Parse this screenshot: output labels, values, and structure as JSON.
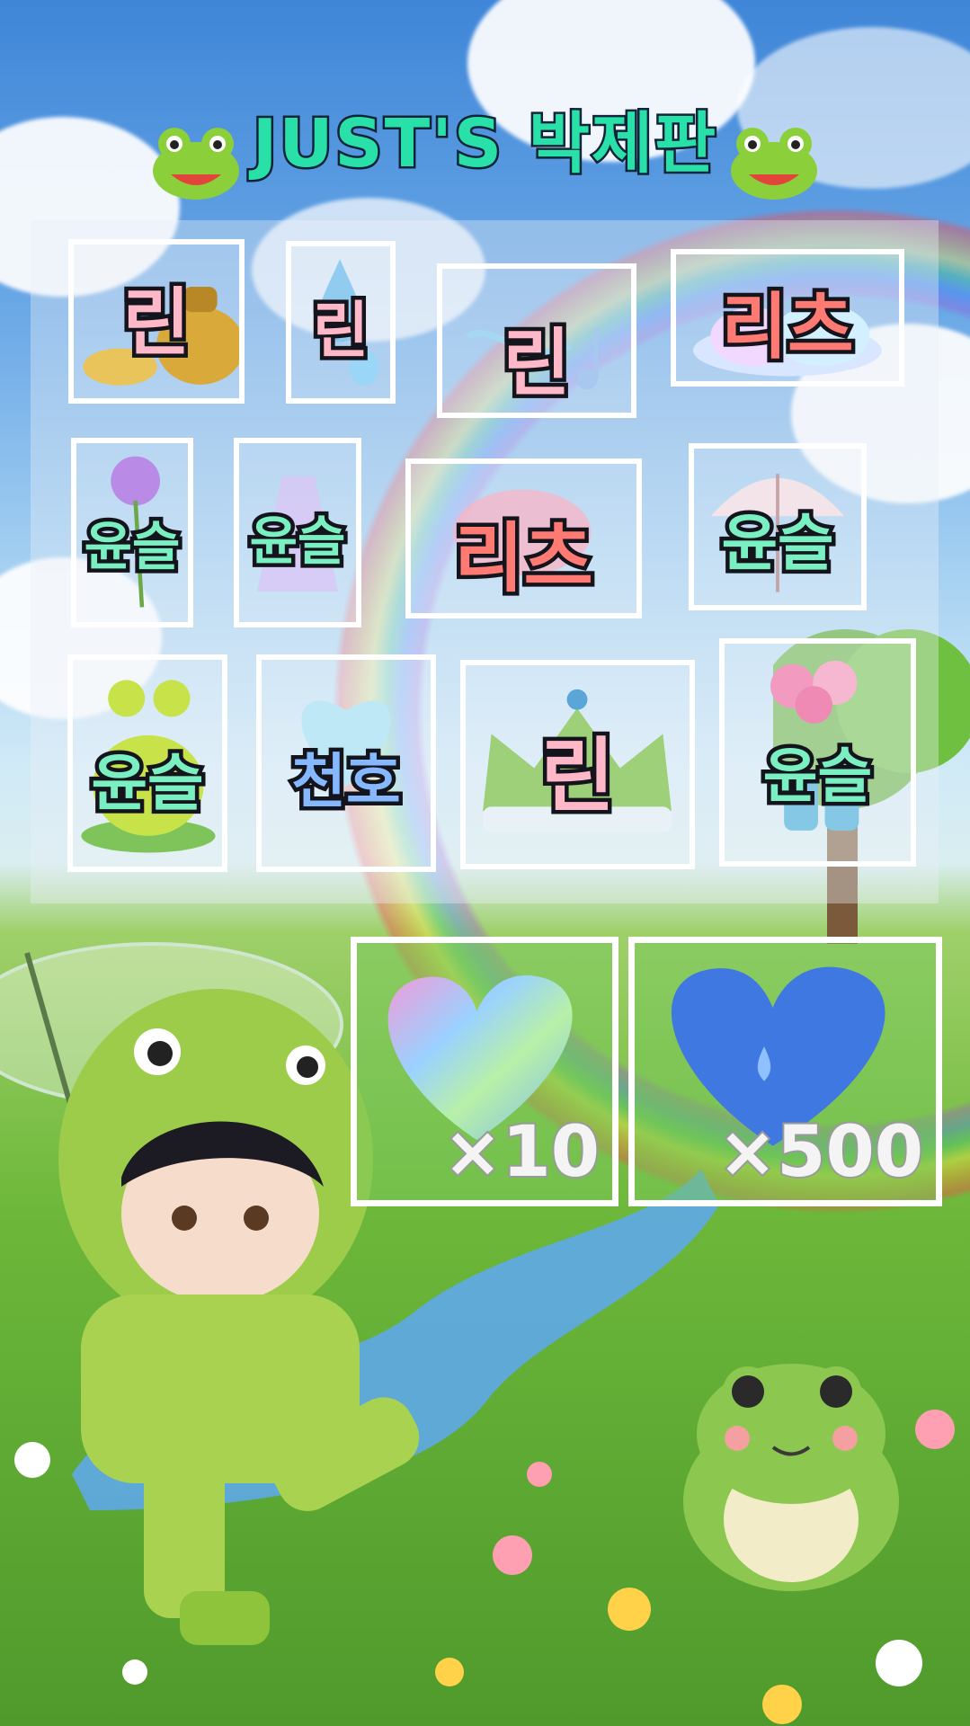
{
  "title": {
    "text": "JUST'S 박제판",
    "left_icon": "frog-face-icon",
    "right_icon": "frog-face-icon"
  },
  "cards": [
    {
      "id": "kettle",
      "label": "린",
      "color": "black",
      "icon": "kettle-icon"
    },
    {
      "id": "water-drop",
      "label": "린",
      "color": "black",
      "icon": "water-drop-icon"
    },
    {
      "id": "music-notes",
      "label": "린",
      "color": "black",
      "icon": "music-notes-icon"
    },
    {
      "id": "cloud",
      "label": "리츠",
      "color": "pink",
      "icon": "cloud-icon"
    },
    {
      "id": "rose",
      "label": "윤슬",
      "color": "mint",
      "icon": "rose-icon"
    },
    {
      "id": "dress",
      "label": "윤슬",
      "color": "mint",
      "icon": "dress-icon"
    },
    {
      "id": "pink-cloud",
      "label": "리츠",
      "color": "pink",
      "icon": "pink-cloud-icon"
    },
    {
      "id": "umbrella",
      "label": "윤슬",
      "color": "mint",
      "icon": "umbrella-icon"
    },
    {
      "id": "frog",
      "label": "윤슬",
      "color": "mint",
      "icon": "frog-icon"
    },
    {
      "id": "heart-balloon",
      "label": "천호",
      "color": "blue",
      "icon": "heart-balloon-icon"
    },
    {
      "id": "crown",
      "label": "린",
      "color": "black",
      "icon": "crown-icon"
    },
    {
      "id": "bouquet",
      "label": "윤슬",
      "color": "mint",
      "icon": "bouquet-boots-icon"
    }
  ],
  "rewards": [
    {
      "id": "rainbow-heart",
      "multiplier": "×10",
      "icon": "rainbow-heart-icon"
    },
    {
      "id": "blue-heart",
      "multiplier": "×500",
      "icon": "blue-heart-icon"
    }
  ],
  "scene": {
    "character": "boy-in-frog-raincoat",
    "companion": "frog",
    "colors": {
      "title_fill": "#29e0a8",
      "card_border": "#ffffff",
      "grass": "#6db83a",
      "sky": "#6aa8e6"
    }
  }
}
